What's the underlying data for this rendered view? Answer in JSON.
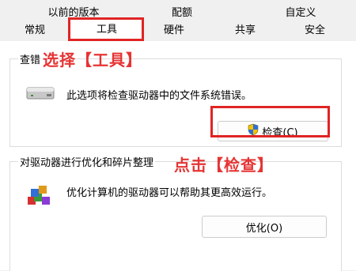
{
  "tabs": {
    "row1": [
      "以前的版本",
      "配额",
      "自定义"
    ],
    "row2": [
      "常规",
      "工具",
      "硬件",
      "共享",
      "安全"
    ]
  },
  "check_group": {
    "title": "查错",
    "description": "此选项将检查驱动器中的文件系统错误。",
    "button_label": "检查(C)",
    "icon": "drive-icon"
  },
  "optimize_group": {
    "title": "对驱动器进行优化和碎片整理",
    "description": "优化计算机的驱动器可以帮助其更高效运行。",
    "button_label": "优化(O)",
    "icon": "defrag-icon"
  },
  "annotations": {
    "select_tools": "选择【工具】",
    "click_check": "点击【检查】"
  },
  "colors": {
    "highlight_red": "#e02424",
    "annotation_red": "#e63434"
  }
}
